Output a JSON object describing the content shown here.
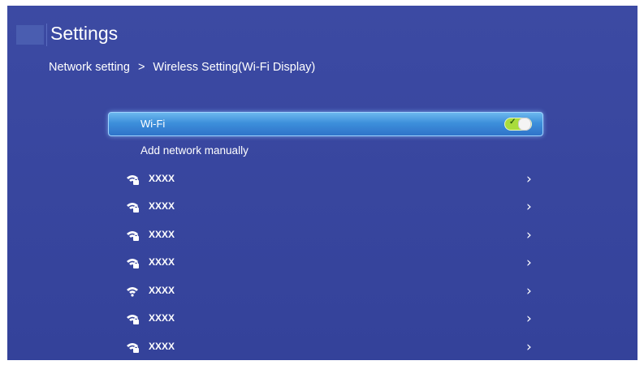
{
  "header": {
    "title": "Settings"
  },
  "breadcrumb": {
    "parent": "Network setting",
    "separator": ">",
    "current": "Wireless Setting(Wi-Fi Display)"
  },
  "wifi": {
    "label": "Wi-Fi",
    "enabled": true,
    "toggle_check": "✓"
  },
  "add_network": {
    "label": "Add network manually"
  },
  "networks": [
    {
      "name": "XXXX",
      "icon": "wifi-locked-icon"
    },
    {
      "name": "XXXX",
      "icon": "wifi-locked-icon"
    },
    {
      "name": "XXXX",
      "icon": "wifi-locked-icon"
    },
    {
      "name": "XXXX",
      "icon": "wifi-locked-icon"
    },
    {
      "name": "XXXX",
      "icon": "wifi-icon"
    },
    {
      "name": "XXXX",
      "icon": "wifi-locked-icon"
    },
    {
      "name": "XXXX",
      "icon": "wifi-locked-icon"
    }
  ],
  "chevron": "›",
  "colors": {
    "background": "#3c4aa3",
    "highlight": "#3d8fdb",
    "toggle_on": "#a9dc3c"
  }
}
